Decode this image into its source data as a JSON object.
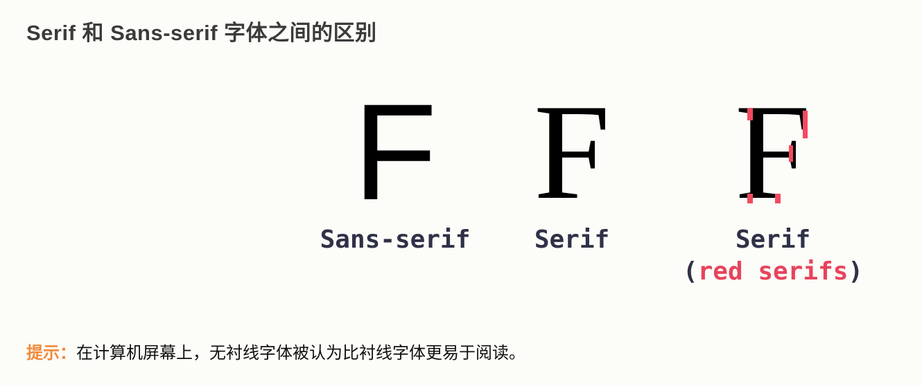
{
  "title": "Serif 和 Sans-serif 字体之间的区别",
  "figure": {
    "glyph_letter": "F",
    "captions": {
      "sans": "Sans-serif",
      "serif": "Serif",
      "serif_red": "Serif",
      "paren_open": "(",
      "red_serifs": "red serifs",
      "paren_close": ")"
    },
    "colors": {
      "caption": "#2f3147",
      "red": "#e8435c",
      "glyph": "#000000"
    }
  },
  "tip": {
    "label": "提示：",
    "text": "在计算机屏幕上，无衬线字体被认为比衬线字体更易于阅读。"
  },
  "colors": {
    "title": "#3b3b3b",
    "tip_label": "#f18a3b",
    "background": "#fcfcf8"
  }
}
